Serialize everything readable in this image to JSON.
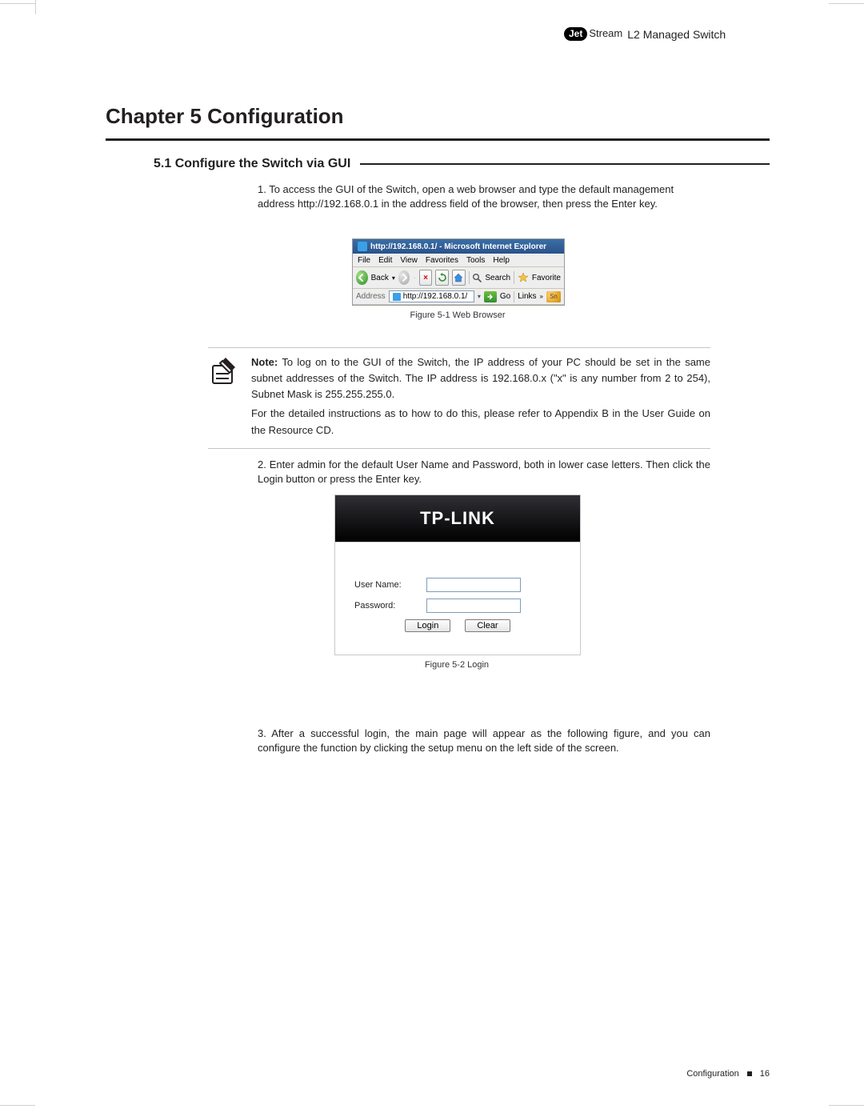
{
  "header": {
    "brand_prefix": "Jet",
    "brand_suffix_stream": "Stream",
    "brand_tagline": "L2 Managed Switch"
  },
  "chapter": {
    "title": "Chapter 5  Configuration"
  },
  "section": {
    "title": "5.1 Configure the Switch via GUI"
  },
  "steps": {
    "s1": "1. To access the GUI of the Switch, open a web browser and type the default management address http://192.168.0.1 in the address field of the browser, then press the Enter key.",
    "s2": "2. Enter admin for the default User Name and Password, both in lower case letters. Then click the Login button or press the Enter key.",
    "s3": "3. After a successful login, the main page will appear as the following figure, and you can configure the function by clicking the setup menu on the left side of the screen."
  },
  "figure1": {
    "title": "http://192.168.0.1/ - Microsoft Internet Explorer",
    "menus": {
      "file": "File",
      "edit": "Edit",
      "view": "View",
      "favorites": "Favorites",
      "tools": "Tools",
      "help": "Help"
    },
    "toolbar": {
      "back": "Back",
      "search": "Search",
      "favorites_btn": "Favorite"
    },
    "address_label": "Address",
    "address_value": "http://192.168.0.1/",
    "go_label": "Go",
    "links_label": "Links",
    "sn_label": "Sn",
    "caption": "Figure 5-1  Web Browser"
  },
  "note": {
    "label": "Note:",
    "p1": "To log on to the GUI of the Switch, the IP address of your PC should be set in the same subnet addresses of the Switch. The IP address is 192.168.0.x (\"x\" is any number from 2 to 254), Subnet Mask is 255.255.255.0.",
    "p2": "For the detailed instructions as to how to do this, please refer to Appendix B in the User Guide on the Resource CD."
  },
  "figure2": {
    "brand": "TP-LINK",
    "username_label": "User Name:",
    "password_label": "Password:",
    "login_btn": "Login",
    "clear_btn": "Clear",
    "caption": "Figure 5-2  Login"
  },
  "footer": {
    "section": "Configuration",
    "page": "16"
  }
}
